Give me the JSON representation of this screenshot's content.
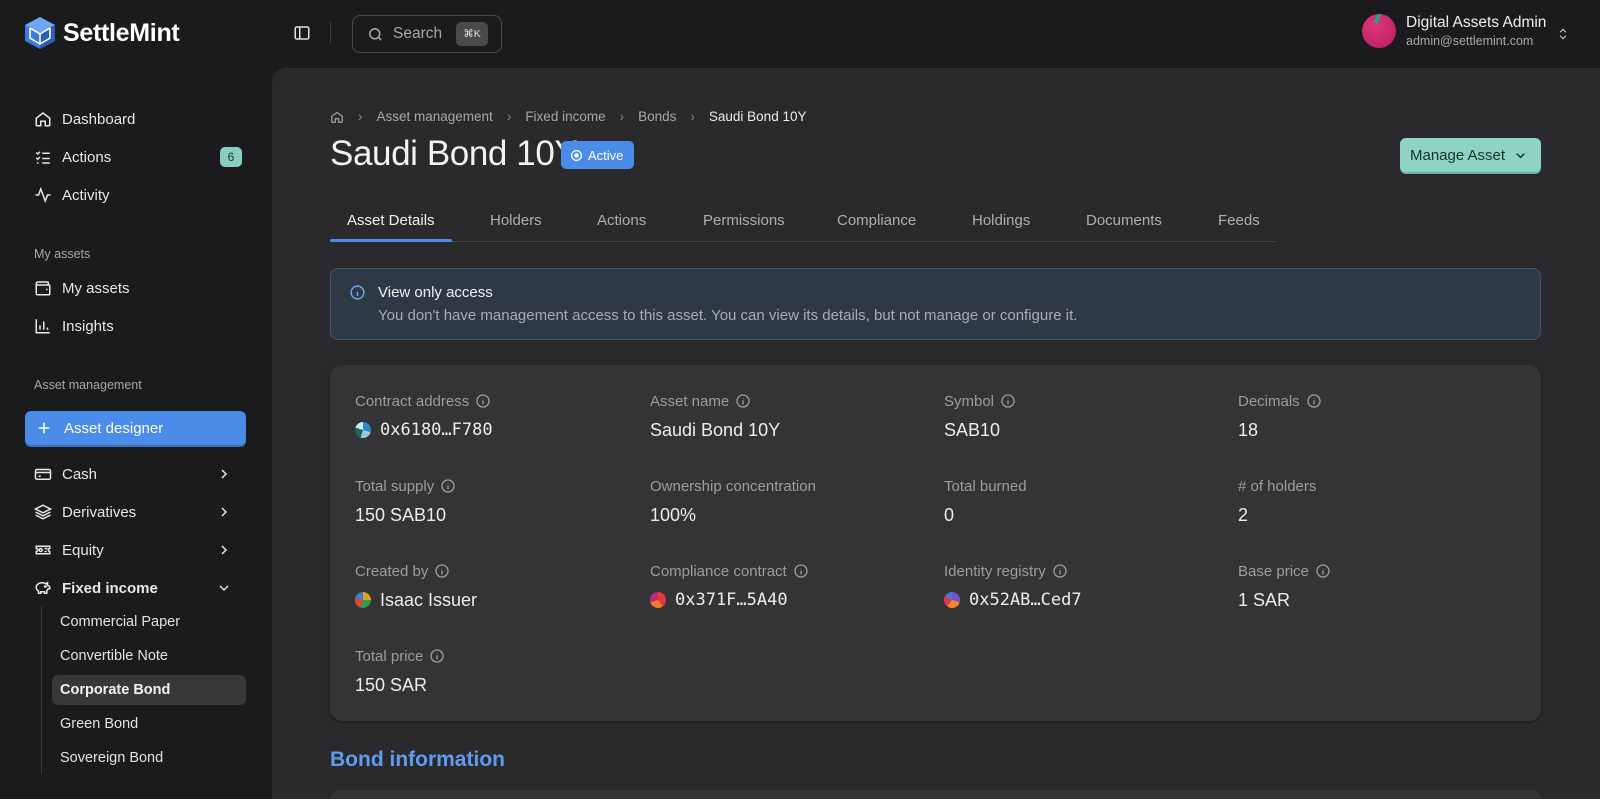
{
  "app": {
    "name": "SettleMint"
  },
  "topbar": {
    "search_placeholder": "Search",
    "search_shortcut": "⌘K",
    "user": {
      "name": "Digital Assets Admin",
      "email": "admin@settlemint.com"
    }
  },
  "sidebar": {
    "main": [
      {
        "label": "Dashboard",
        "icon": "home-icon"
      },
      {
        "label": "Actions",
        "icon": "list-check-icon",
        "badge": "6"
      },
      {
        "label": "Activity",
        "icon": "activity-icon"
      }
    ],
    "my_assets_section": "My assets",
    "my_assets": [
      {
        "label": "My assets",
        "icon": "wallet-icon"
      },
      {
        "label": "Insights",
        "icon": "bar-chart-icon"
      }
    ],
    "asset_management_section": "Asset management",
    "asset_designer_label": "Asset designer",
    "categories": [
      {
        "label": "Cash",
        "icon": "banknote-icon"
      },
      {
        "label": "Derivatives",
        "icon": "layers-icon"
      },
      {
        "label": "Equity",
        "icon": "ticket-icon"
      },
      {
        "label": "Fixed income",
        "icon": "piggy-bank-icon"
      }
    ],
    "fixed_income_items": [
      "Commercial Paper",
      "Convertible Note",
      "Corporate Bond",
      "Green Bond",
      "Sovereign Bond"
    ],
    "fixed_income_active": "Corporate Bond"
  },
  "breadcrumb": [
    "Asset management",
    "Fixed income",
    "Bonds",
    "Saudi Bond 10Y"
  ],
  "page": {
    "title": "Saudi Bond 10Y",
    "status": "Active",
    "manage_label": "Manage Asset"
  },
  "tabs": [
    "Asset Details",
    "Holders",
    "Actions",
    "Permissions",
    "Compliance",
    "Holdings",
    "Documents",
    "Feeds"
  ],
  "active_tab": "Asset Details",
  "alert": {
    "title": "View only access",
    "text": "You don't have management access to this asset. You can view its details, but not manage or configure it."
  },
  "details": {
    "contract_address": {
      "label": "Contract address",
      "value": "0x6180…F780"
    },
    "asset_name": {
      "label": "Asset name",
      "value": "Saudi Bond 10Y"
    },
    "symbol": {
      "label": "Symbol",
      "value": "SAB10"
    },
    "decimals": {
      "label": "Decimals",
      "value": "18"
    },
    "total_supply": {
      "label": "Total supply",
      "value": "150 SAB10"
    },
    "ownership_concentration": {
      "label": "Ownership concentration",
      "value": "100%"
    },
    "total_burned": {
      "label": "Total burned",
      "value": "0"
    },
    "holders": {
      "label": "# of holders",
      "value": "2"
    },
    "created_by": {
      "label": "Created by",
      "value": "Isaac Issuer"
    },
    "compliance_contract": {
      "label": "Compliance contract",
      "value": "0x371F…5A40"
    },
    "identity_registry": {
      "label": "Identity registry",
      "value": "0x52AB…Ced7"
    },
    "base_price": {
      "label": "Base price",
      "value": "1 SAR"
    },
    "total_price": {
      "label": "Total price",
      "value": "150 SAR"
    }
  },
  "bond_section_title": "Bond information",
  "colors": {
    "accent": "#4b8ce8",
    "manage": "#8fd4c3",
    "badge": "#88cfbf"
  }
}
